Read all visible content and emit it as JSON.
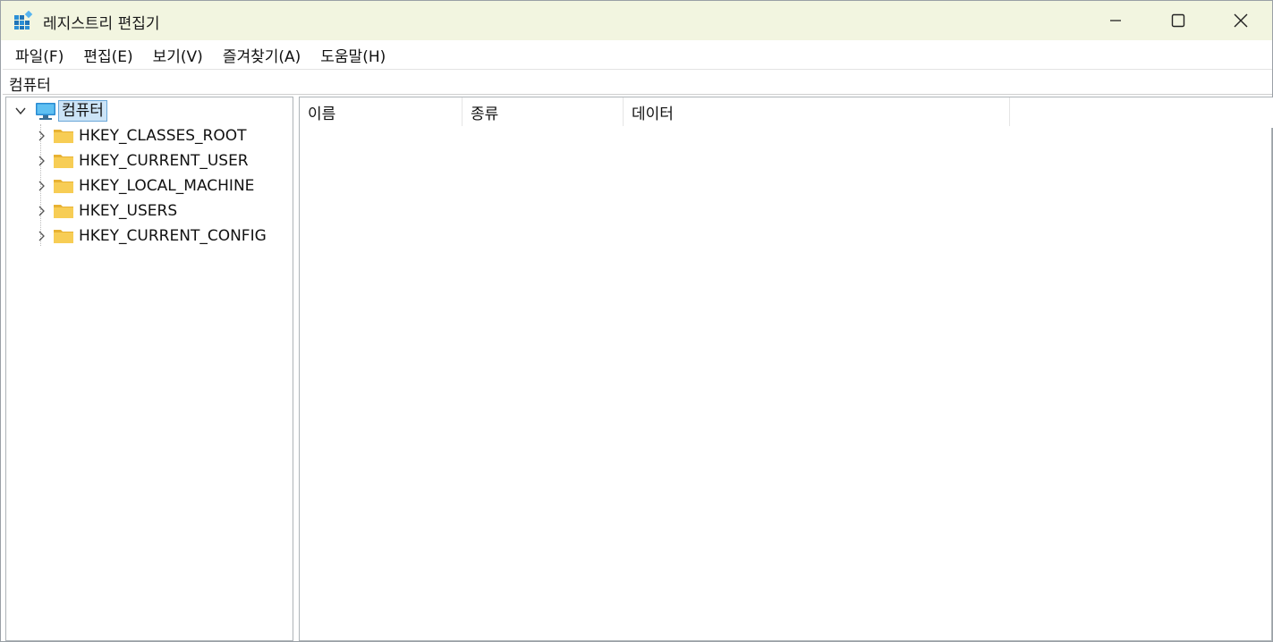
{
  "window": {
    "title": "레지스트리 편집기",
    "icon": "registry-editor-icon"
  },
  "menu": [
    "파일(F)",
    "편집(E)",
    "보기(V)",
    "즐겨찾기(A)",
    "도움말(H)"
  ],
  "address": "컴퓨터",
  "tree": {
    "root": {
      "label": "컴퓨터",
      "icon": "computer-icon",
      "expanded": true,
      "selected": true
    },
    "children": [
      {
        "label": "HKEY_CLASSES_ROOT",
        "icon": "folder-icon"
      },
      {
        "label": "HKEY_CURRENT_USER",
        "icon": "folder-icon"
      },
      {
        "label": "HKEY_LOCAL_MACHINE",
        "icon": "folder-icon"
      },
      {
        "label": "HKEY_USERS",
        "icon": "folder-icon"
      },
      {
        "label": "HKEY_CURRENT_CONFIG",
        "icon": "folder-icon"
      }
    ]
  },
  "list": {
    "columns": [
      "이름",
      "종류",
      "데이터"
    ],
    "rows": []
  },
  "colors": {
    "titlebar_bg": "#f2f5e0",
    "selection_bg": "#cce4f7",
    "selection_border": "#6aa7d8",
    "folder": "#f4c542"
  }
}
